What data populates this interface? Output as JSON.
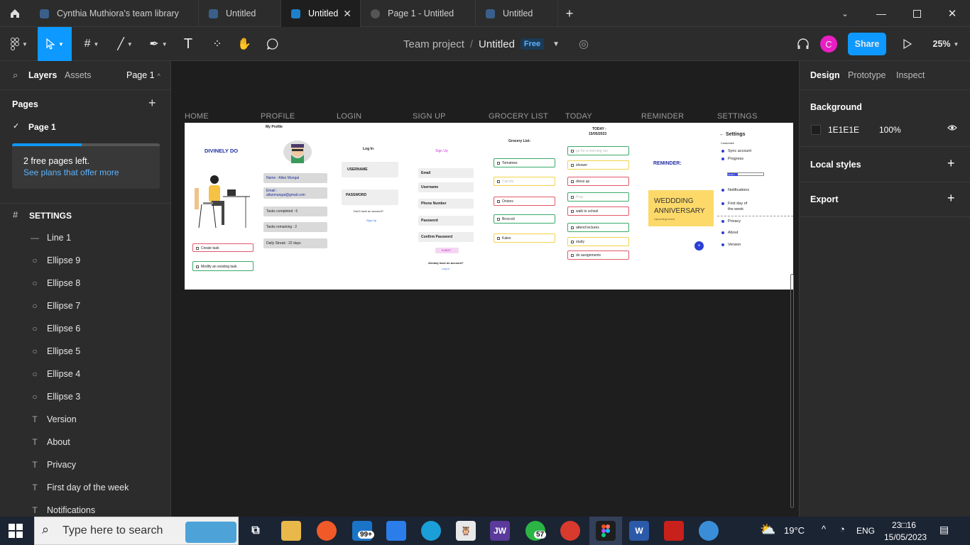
{
  "tabs": [
    {
      "label": "Cynthia Muthiora's team library"
    },
    {
      "label": "Untitled"
    },
    {
      "label": "Untitled"
    },
    {
      "label": "Page 1 - Untitled"
    },
    {
      "label": "Untitled"
    }
  ],
  "header": {
    "team": "Team project",
    "separator": "/",
    "file": "Untitled",
    "badge": "Free",
    "avatar": "C",
    "share": "Share",
    "zoom": "25%"
  },
  "left": {
    "tab_layers": "Layers",
    "tab_assets": "Assets",
    "page_selector": "Page 1",
    "pages_title": "Pages",
    "current_page": "Page 1",
    "promo_text": "2 free pages left.",
    "promo_link": "See plans that offer more",
    "frame_name": "SETTINGS",
    "layers": [
      {
        "icon": "line-icon",
        "label": "Line 1"
      },
      {
        "icon": "ellipse-icon",
        "label": "Ellipse 9"
      },
      {
        "icon": "ellipse-icon",
        "label": "Ellipse 8"
      },
      {
        "icon": "ellipse-icon",
        "label": "Ellipse 7"
      },
      {
        "icon": "ellipse-icon",
        "label": "Ellipse 6"
      },
      {
        "icon": "ellipse-icon",
        "label": "Ellipse 5"
      },
      {
        "icon": "ellipse-icon",
        "label": "Ellipse 4"
      },
      {
        "icon": "ellipse-icon",
        "label": "Ellipse 3"
      },
      {
        "icon": "text-icon",
        "label": "Version"
      },
      {
        "icon": "text-icon",
        "label": "About"
      },
      {
        "icon": "text-icon",
        "label": "Privacy"
      },
      {
        "icon": "text-icon",
        "label": "First day of the week"
      },
      {
        "icon": "text-icon",
        "label": "Notifications"
      }
    ]
  },
  "right": {
    "tab_design": "Design",
    "tab_prototype": "Prototype",
    "tab_inspect": "Inspect",
    "background_title": "Background",
    "bg_hex": "1E1E1E",
    "bg_opacity": "100%",
    "local_styles": "Local styles",
    "export": "Export"
  },
  "frames": {
    "labels": [
      "HOME",
      "PROFILE",
      "LOGIN",
      "SIGN UP",
      "GROCERY LIST",
      "TODAY",
      "REMINDER",
      "SETTINGS"
    ],
    "home": {
      "brand": "DIVINELY DO",
      "btn1": "Create task",
      "btn2": "Modify an existing task"
    },
    "profile": {
      "title": "My Profile",
      "name": "Name : Allan Mungai",
      "email_label": "Email :",
      "email": "allanmungai@gmail.com",
      "done": "Tasks completed : 6",
      "remaining": "Tasks remaining : 2",
      "streak": "Daily Streak : 22 days"
    },
    "login": {
      "title": "Log In",
      "username": "USERNAME",
      "password": "PASSWORD",
      "no_account": "Don't have an account?",
      "signup": "Sign Up"
    },
    "signup": {
      "title": "Sign Up",
      "fields": [
        "Email",
        "Username",
        "Phone Number",
        "Password",
        "Confirm Password"
      ],
      "submit": "SUBMIT",
      "have_account": "Already have an account?",
      "login": "Log in"
    },
    "grocery": {
      "title": "Grocery List:",
      "items": [
        "Tomatoes",
        "Carrots",
        "Onions",
        "Broccoli",
        "Kales"
      ]
    },
    "today": {
      "title": "TODAY -",
      "date": "15/05/2023",
      "items": [
        "go for a morning run",
        "shower",
        "dress up",
        "Pray",
        "walk to school",
        "attend lectures",
        "study",
        "do assignments"
      ]
    },
    "reminder": {
      "title": "REMINDER:",
      "card_line1": "WEDDDING",
      "card_line2": "ANNIVERSARY",
      "card_sub": "Upcoming event"
    },
    "settings": {
      "title": "Settings",
      "section": "Customize",
      "items": [
        "Sync account",
        "Progress"
      ],
      "progress_label": "Level 1",
      "items2": [
        "Notifications",
        "First day of",
        "the week",
        "Privacy",
        "About",
        "Version"
      ]
    }
  },
  "taskbar": {
    "search_placeholder": "Type here to search",
    "mail_badge": "99+",
    "whatsapp_badge": "57",
    "weather": "19°C",
    "lang": "ENG",
    "time": "23□16",
    "date": "15/05/2023"
  },
  "help": "?"
}
